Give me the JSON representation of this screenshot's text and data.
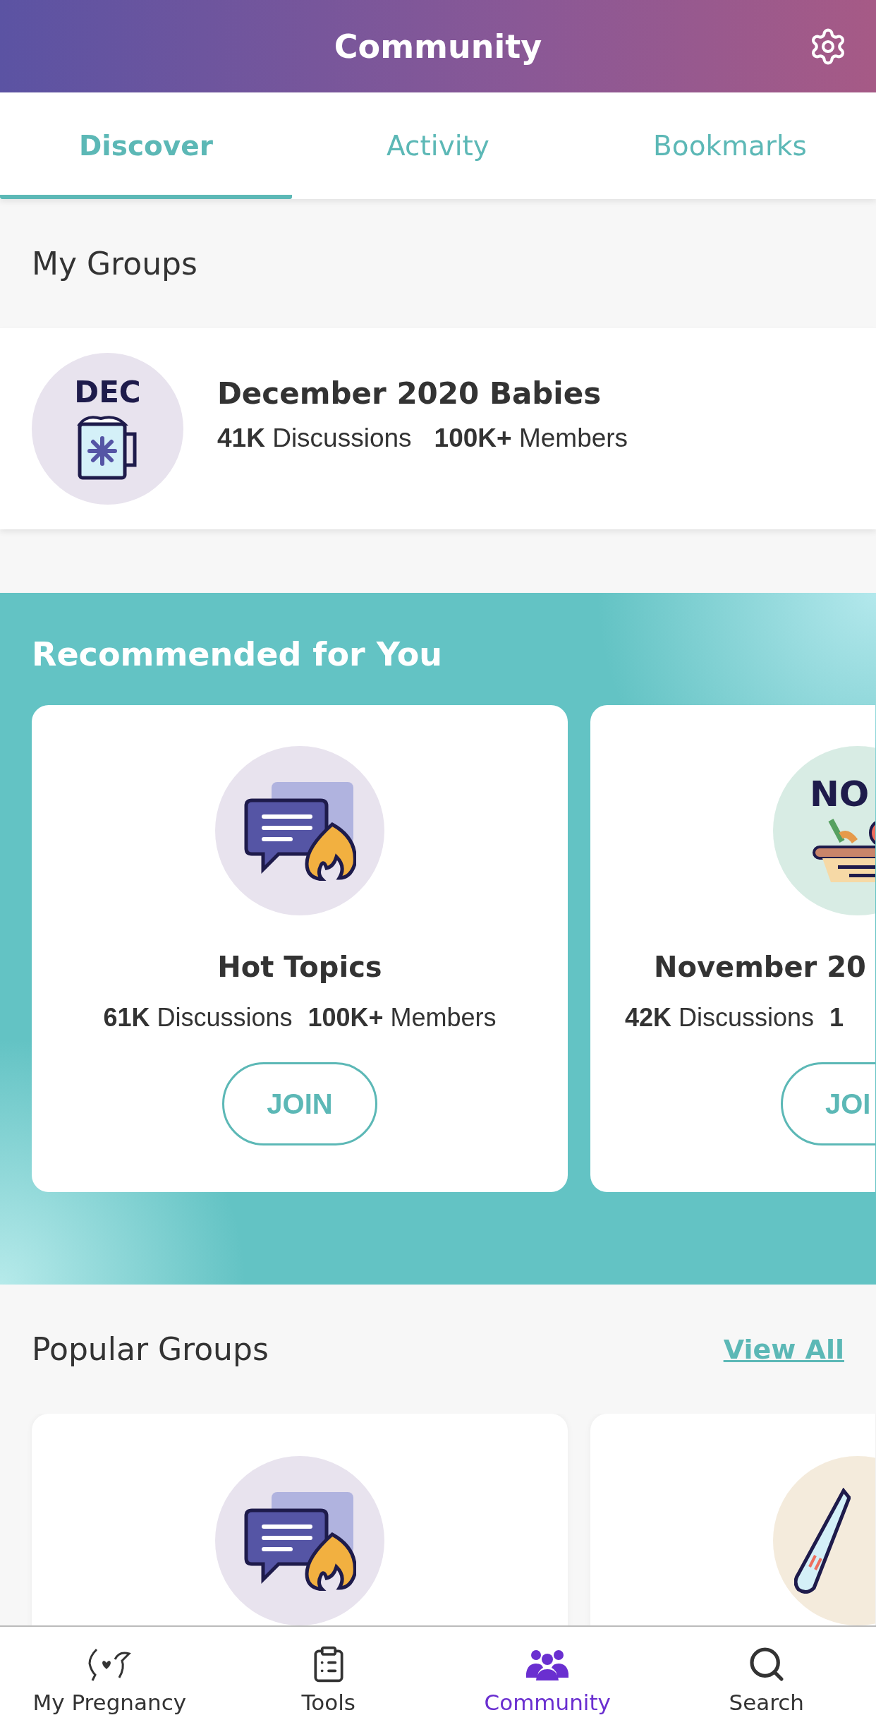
{
  "header": {
    "title": "Community"
  },
  "tabs": [
    {
      "label": "Discover",
      "selected": true
    },
    {
      "label": "Activity",
      "selected": false
    },
    {
      "label": "Bookmarks",
      "selected": false
    }
  ],
  "my_groups": {
    "title": "My Groups",
    "groups": [
      {
        "badge": "DEC",
        "name": "December 2020 Babies",
        "discussions": "**41K** Discussions",
        "members": "**100K+** Members"
      }
    ]
  },
  "recommended": {
    "title": "Recommended for You",
    "cards": [
      {
        "kind": "topic",
        "name": "Hot Topics",
        "discussions": "**61K** Discussions",
        "members": "**100K+** Members",
        "button": "JOIN"
      },
      {
        "kind": "month",
        "badge": "NO",
        "name": "November 20",
        "discussions": "**42K** Discussions",
        "members": "**1**",
        "button": "JOI"
      }
    ]
  },
  "popular": {
    "title": "Popular Groups",
    "link": "View All"
  },
  "bottom_nav": [
    {
      "label": "My Pregnancy",
      "kind": "pregnancy",
      "selected": false
    },
    {
      "label": "Tools",
      "kind": "tools",
      "selected": false
    },
    {
      "label": "Community",
      "kind": "community",
      "selected": true
    },
    {
      "label": "Search",
      "kind": "search",
      "selected": false
    }
  ]
}
